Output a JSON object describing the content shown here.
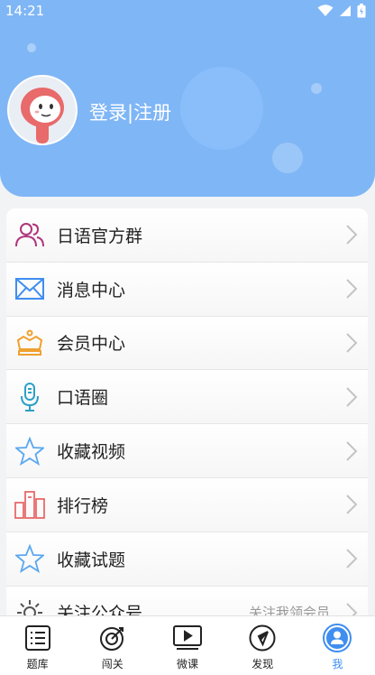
{
  "status_bar": {
    "time": "14:21"
  },
  "profile": {
    "login_label": "登录|注册"
  },
  "menu": {
    "items": [
      {
        "label": "日语官方群",
        "icon": "group-icon"
      },
      {
        "label": "消息中心",
        "icon": "mail-icon"
      },
      {
        "label": "会员中心",
        "icon": "crown-icon"
      },
      {
        "label": "口语圈",
        "icon": "microphone-icon"
      },
      {
        "label": "收藏视频",
        "icon": "star-icon"
      },
      {
        "label": "排行榜",
        "icon": "ranking-icon"
      },
      {
        "label": "收藏试题",
        "icon": "star-icon"
      },
      {
        "label": "关注公众号",
        "icon": "gear-icon",
        "extra": "关注我领会员"
      }
    ]
  },
  "tabbar": {
    "tabs": [
      {
        "label": "题库",
        "icon": "list-icon"
      },
      {
        "label": "闯关",
        "icon": "target-icon"
      },
      {
        "label": "微课",
        "icon": "play-icon"
      },
      {
        "label": "发现",
        "icon": "compass-icon"
      },
      {
        "label": "我",
        "icon": "user-icon",
        "active": true
      }
    ]
  },
  "colors": {
    "header": "#7fb6f6",
    "accent": "#3f8ef0"
  }
}
